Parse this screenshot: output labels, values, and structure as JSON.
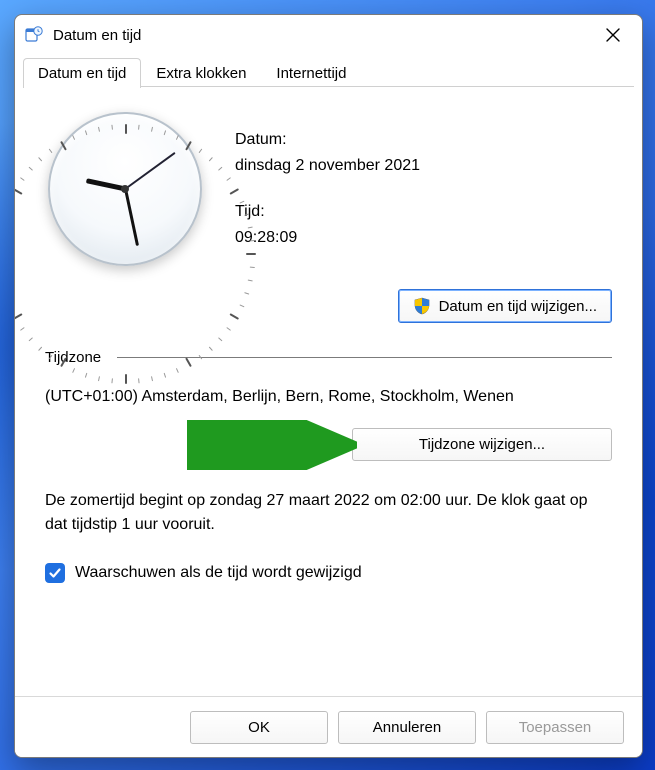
{
  "window": {
    "title": "Datum en tijd"
  },
  "tabs": {
    "t0": "Datum en tijd",
    "t1": "Extra klokken",
    "t2": "Internettijd"
  },
  "datetime": {
    "date_label": "Datum:",
    "date_value": "dinsdag 2 november 2021",
    "time_label": "Tijd:",
    "time_value": "09:28:09",
    "change_button": "Datum en tijd wijzigen..."
  },
  "timezone": {
    "heading": "Tijdzone",
    "value": "(UTC+01:00) Amsterdam, Berlijn, Bern, Rome, Stockholm, Wenen",
    "change_button": "Tijdzone wijzigen..."
  },
  "dst_text": "De zomertijd begint op zondag 27 maart 2022 om 02:00 uur. De klok gaat op dat tijdstip 1 uur vooruit.",
  "notify_checkbox": {
    "label": "Waarschuwen als de tijd wordt gewijzigd",
    "checked": true
  },
  "buttons": {
    "ok": "OK",
    "cancel": "Annuleren",
    "apply": "Toepassen"
  },
  "clock": {
    "hour_angle": 282,
    "minute_angle": 168,
    "second_angle": 54
  },
  "colors": {
    "accent": "#1f6fe0",
    "arrow": "#2e9e2e"
  }
}
